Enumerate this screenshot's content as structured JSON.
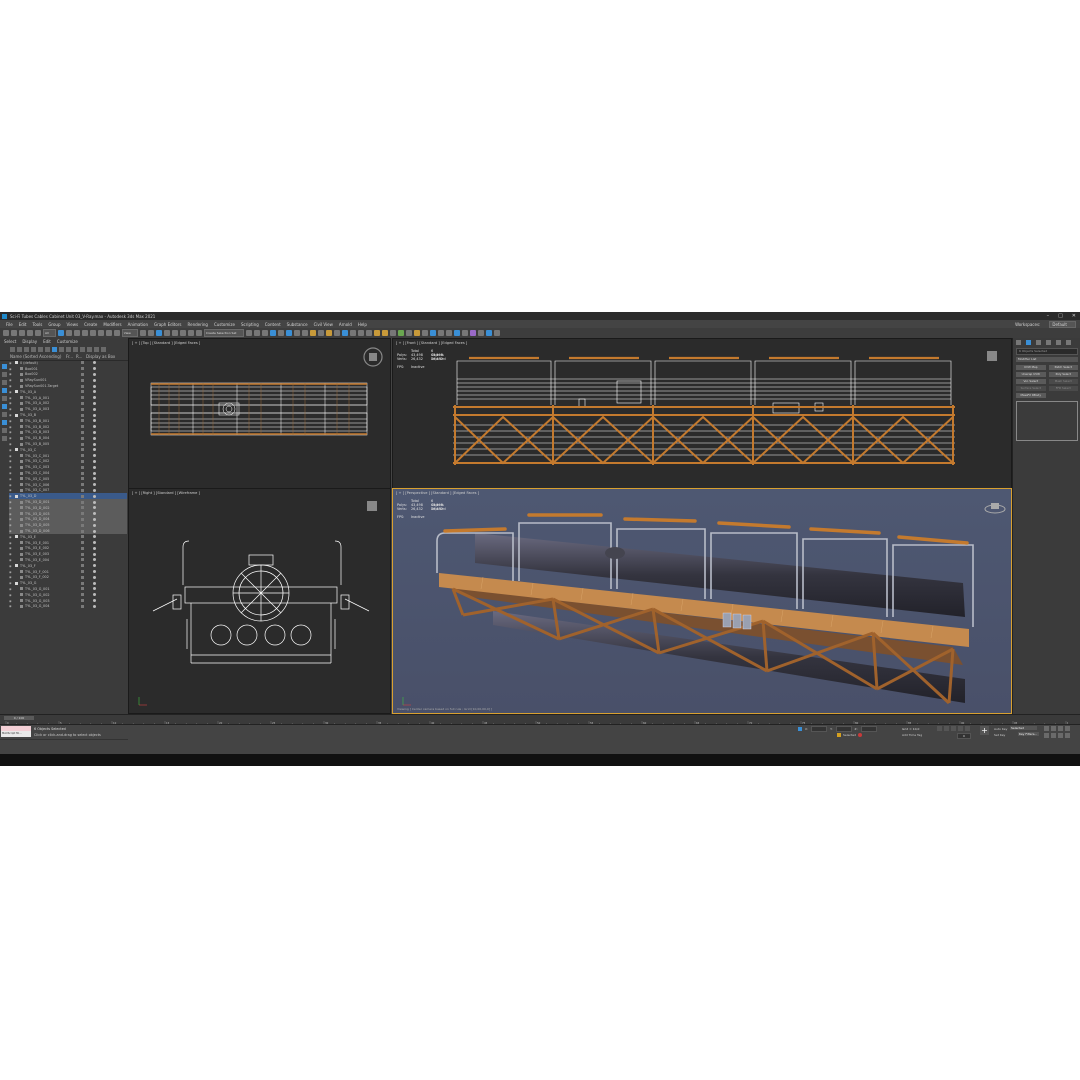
{
  "window": {
    "title": "Sci-Fi Tubes Cables Cabinet Unit 03_V-Ray.max - Autodesk 3ds Max 2021"
  },
  "menu": [
    "File",
    "Edit",
    "Tools",
    "Group",
    "Views",
    "Create",
    "Modifiers",
    "Animation",
    "Graph Editors",
    "Rendering",
    "Customize",
    "Scripting",
    "Content",
    "Substance",
    "Civil View",
    "Arnold",
    "Help"
  ],
  "workspace": {
    "label": "Workspaces:",
    "value": "Default"
  },
  "toolbar": {
    "undo_dd": "All",
    "view_dd": "View",
    "selset_dd": "Create Selection Set"
  },
  "explorer": {
    "menu": [
      "Select",
      "Display",
      "Edit",
      "Customize"
    ],
    "columns": {
      "name": "Name (Sorted Ascending)",
      "frozen": "Fr...",
      "renderable": "R...",
      "display_box": "Display as Box"
    },
    "rows": [
      {
        "label": "0 (default)",
        "indent": 0,
        "type": "layer",
        "state": ""
      },
      {
        "label": "Box001",
        "indent": 1,
        "type": "obj",
        "state": ""
      },
      {
        "label": "Box002",
        "indent": 1,
        "type": "obj",
        "state": ""
      },
      {
        "label": "VRaySun001",
        "indent": 1,
        "type": "obj",
        "state": ""
      },
      {
        "label": "VRaySun001.Target",
        "indent": 1,
        "type": "obj",
        "state": ""
      },
      {
        "label": "TYL_03_A",
        "indent": 0,
        "type": "layer",
        "state": ""
      },
      {
        "label": "TYL_03_A_001",
        "indent": 1,
        "type": "obj",
        "state": ""
      },
      {
        "label": "TYL_03_A_002",
        "indent": 1,
        "type": "obj",
        "state": ""
      },
      {
        "label": "TYL_03_A_003",
        "indent": 1,
        "type": "obj",
        "state": ""
      },
      {
        "label": "TYL_03_B",
        "indent": 0,
        "type": "layer",
        "state": ""
      },
      {
        "label": "TYL_03_B_001",
        "indent": 1,
        "type": "obj",
        "state": ""
      },
      {
        "label": "TYL_03_B_002",
        "indent": 1,
        "type": "obj",
        "state": ""
      },
      {
        "label": "TYL_03_B_003",
        "indent": 1,
        "type": "obj",
        "state": ""
      },
      {
        "label": "TYL_03_B_004",
        "indent": 1,
        "type": "obj",
        "state": ""
      },
      {
        "label": "TYL_03_B_005",
        "indent": 1,
        "type": "obj",
        "state": ""
      },
      {
        "label": "TYL_03_C",
        "indent": 0,
        "type": "layer",
        "state": ""
      },
      {
        "label": "TYL_03_C_001",
        "indent": 1,
        "type": "obj",
        "state": ""
      },
      {
        "label": "TYL_03_C_002",
        "indent": 1,
        "type": "obj",
        "state": ""
      },
      {
        "label": "TYL_03_C_003",
        "indent": 1,
        "type": "obj",
        "state": ""
      },
      {
        "label": "TYL_03_C_004",
        "indent": 1,
        "type": "obj",
        "state": ""
      },
      {
        "label": "TYL_03_C_005",
        "indent": 1,
        "type": "obj",
        "state": ""
      },
      {
        "label": "TYL_03_C_006",
        "indent": 1,
        "type": "obj",
        "state": ""
      },
      {
        "label": "TYL_03_C_007",
        "indent": 1,
        "type": "obj",
        "state": ""
      },
      {
        "label": "TYL_03_D",
        "indent": 0,
        "type": "layer",
        "state": "hl"
      },
      {
        "label": "TYL_03_D_001",
        "indent": 1,
        "type": "obj",
        "state": "sel"
      },
      {
        "label": "TYL_03_D_002",
        "indent": 1,
        "type": "obj",
        "state": "sel"
      },
      {
        "label": "TYL_03_D_003",
        "indent": 1,
        "type": "obj",
        "state": "sel"
      },
      {
        "label": "TYL_03_D_004",
        "indent": 1,
        "type": "obj",
        "state": "sel"
      },
      {
        "label": "TYL_03_D_005",
        "indent": 1,
        "type": "obj",
        "state": "sel"
      },
      {
        "label": "TYL_03_D_006",
        "indent": 1,
        "type": "obj",
        "state": "sel"
      },
      {
        "label": "TYL_03_E",
        "indent": 0,
        "type": "layer",
        "state": ""
      },
      {
        "label": "TYL_03_E_001",
        "indent": 1,
        "type": "obj",
        "state": ""
      },
      {
        "label": "TYL_03_E_002",
        "indent": 1,
        "type": "obj",
        "state": ""
      },
      {
        "label": "TYL_03_E_003",
        "indent": 1,
        "type": "obj",
        "state": ""
      },
      {
        "label": "TYL_03_E_004",
        "indent": 1,
        "type": "obj",
        "state": ""
      },
      {
        "label": "TYL_03_F",
        "indent": 0,
        "type": "layer",
        "state": ""
      },
      {
        "label": "TYL_03_F_001",
        "indent": 1,
        "type": "obj",
        "state": ""
      },
      {
        "label": "TYL_03_F_002",
        "indent": 1,
        "type": "obj",
        "state": ""
      },
      {
        "label": "TYL_03_G",
        "indent": 0,
        "type": "layer",
        "state": ""
      },
      {
        "label": "TYL_03_G_001",
        "indent": 1,
        "type": "obj",
        "state": ""
      },
      {
        "label": "TYL_03_G_002",
        "indent": 1,
        "type": "obj",
        "state": ""
      },
      {
        "label": "TYL_03_G_003",
        "indent": 1,
        "type": "obj",
        "state": ""
      },
      {
        "label": "TYL_03_G_004",
        "indent": 1,
        "type": "obj",
        "state": ""
      }
    ],
    "footer_label": "Layer Explorer",
    "footer_dd": "Selection Set:"
  },
  "viewports": {
    "top": {
      "label": "[ + ] [Top ] [Standard ] [Edged Faces ]"
    },
    "front": {
      "label": "[ + ] [Front ] [Standard ] [Edged Faces ]"
    },
    "right": {
      "label": "[ + ] [Right ] [Standard ] [Wireframe ]"
    },
    "persp": {
      "label": "[ + ] [Perspective ] [Standard ] [Edged Faces ]",
      "footer": "Viewing [ Center camera based on full rule ; Grid [10,00,00,0] ]"
    }
  },
  "stats": {
    "total": "Total",
    "selected": "6 Objects Selected",
    "polys_label": "Polys:",
    "polys_total": "43,498",
    "polys_sel": "43,498",
    "verts_label": "Verts:",
    "verts_total": "26,432",
    "verts_sel": "26,432",
    "fps_label": "FPS:",
    "fps_value": "Inactive"
  },
  "command_panel": {
    "field": "6 Objects Selected",
    "modifier_list": "Modifier List",
    "buttons": [
      "UVW Map",
      "Patch Select",
      "Unwrap UVW",
      "Poly Select",
      "Vol. Select",
      "Mesh Select",
      "Surface Select",
      "FFD Select",
      "MassFX RBody"
    ]
  },
  "timeline": {
    "slider": "0 / 100",
    "ticks": [
      "0",
      "5",
      "10",
      "15",
      "20",
      "25",
      "30",
      "35",
      "40",
      "45",
      "50",
      "55",
      "60",
      "65",
      "70",
      "75",
      "80",
      "85",
      "90",
      "95",
      "100"
    ]
  },
  "status": {
    "maxscript": "MAXScript Mi...",
    "line1": "6 Objects Selected",
    "line2": "Click or click-and-drag to select objects",
    "grid": "Grid = 10,0",
    "tag": "Add Time Tag",
    "selected": "Selected",
    "frame": "0",
    "autokey": "Auto Key",
    "setkey": "Set Key",
    "selected_dd": "Selected",
    "key_filters": "Key Filters..."
  },
  "colors": {
    "active_border": "#d8a030",
    "wire": "#ffffff",
    "wood": "#c47a2e",
    "tube": "#3a3a48",
    "persp_bg": "#4c5670",
    "accent": "#3a8fd6"
  }
}
